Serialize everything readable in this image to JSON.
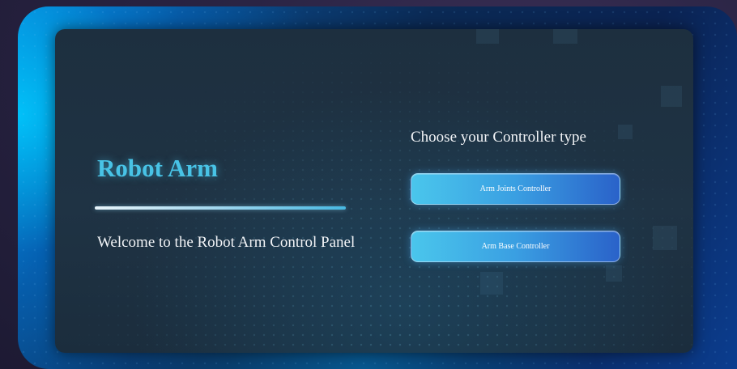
{
  "app": {
    "title": "Robot Arm",
    "welcome_text": "Welcome to the Robot Arm Control Panel"
  },
  "controller_selection": {
    "heading": "Choose your Controller type",
    "buttons": [
      {
        "label": "Arm Joints Controller"
      },
      {
        "label": "Arm Base Controller"
      }
    ]
  },
  "colors": {
    "title": "#48c3e6",
    "button_gradient_start": "#4ac6ec",
    "button_gradient_end": "#2a62c9",
    "panel_bg": "#1f3344",
    "frame_accent": "#0a9fdc"
  }
}
